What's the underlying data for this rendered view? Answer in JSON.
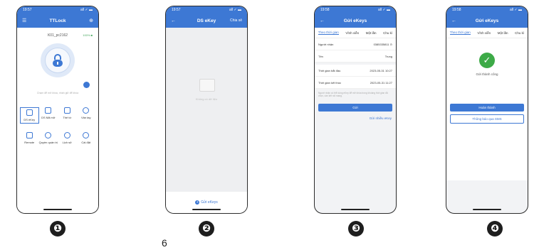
{
  "page_number": "6",
  "markers": [
    "❶",
    "❷",
    "❸",
    "❹"
  ],
  "phone1": {
    "time": "19:57",
    "status_icons": "all ✓ ▬",
    "title": "TTLock",
    "menu_icon": "☰",
    "add_icon": "⊕",
    "lock_name": "K01_pc2162",
    "battery": "100% ■",
    "hint": "Chạm để mở khóa, nhấn giữ để khóa",
    "features": [
      {
        "label": "DS eKey",
        "icon": "key-icon",
        "selected": true
      },
      {
        "label": "DS Mã mở",
        "icon": "passcode-icon",
        "selected": false
      },
      {
        "label": "Thẻ từ",
        "icon": "card-icon",
        "selected": false
      },
      {
        "label": "Vân tay",
        "icon": "fingerprint-icon",
        "selected": false
      },
      {
        "label": "Remote",
        "icon": "remote-icon",
        "selected": false
      },
      {
        "label": "Quyền quản trị",
        "icon": "admin-icon",
        "selected": false
      },
      {
        "label": "Lịch sử",
        "icon": "history-icon",
        "selected": false
      },
      {
        "label": "Cài đặt",
        "icon": "settings-icon",
        "selected": false
      }
    ]
  },
  "phone2": {
    "time": "19:57",
    "status_icons": "all ✓ ▬",
    "back": "←",
    "title": "DS eKey",
    "right": "Chia sẻ",
    "empty_text": "Không có dữ liệu",
    "footer_button": "Gửi eKeys"
  },
  "phone3": {
    "time": "19:58",
    "status_icons": "all ✓ ▬",
    "back": "←",
    "title": "Gửi eKeys",
    "tabs": [
      "Theo thời gian",
      "Vĩnh viễn",
      "Một lần",
      "Chu kì"
    ],
    "fields": [
      {
        "label": "Người nhận",
        "value": "0385335811 ⊙"
      },
      {
        "label": "Tên",
        "value": "Trung"
      },
      {
        "label": "Thời gian bắt đầu",
        "value": "2023-05-31 10:27"
      },
      {
        "label": "Thời gian kết thúc",
        "value": "2023-05-31 11:27"
      }
    ],
    "note": "Người nhận có thể dùng eKey để mở khóa trong khoảng thời gian đã chọn, cần kết nối mạng.",
    "send_button": "Gửi",
    "multi_link": "Gửi nhiều eKey"
  },
  "phone4": {
    "time": "19:58",
    "status_icons": "all ✓ ▬",
    "back": "←",
    "title": "Gửi eKeys",
    "tabs": [
      "Theo thời gian",
      "Vĩnh viễn",
      "Một lần",
      "Chu kì"
    ],
    "success_text": "Gửi thành công",
    "done_button": "Hoàn thành",
    "sms_button": "Thông báo qua SMS"
  }
}
